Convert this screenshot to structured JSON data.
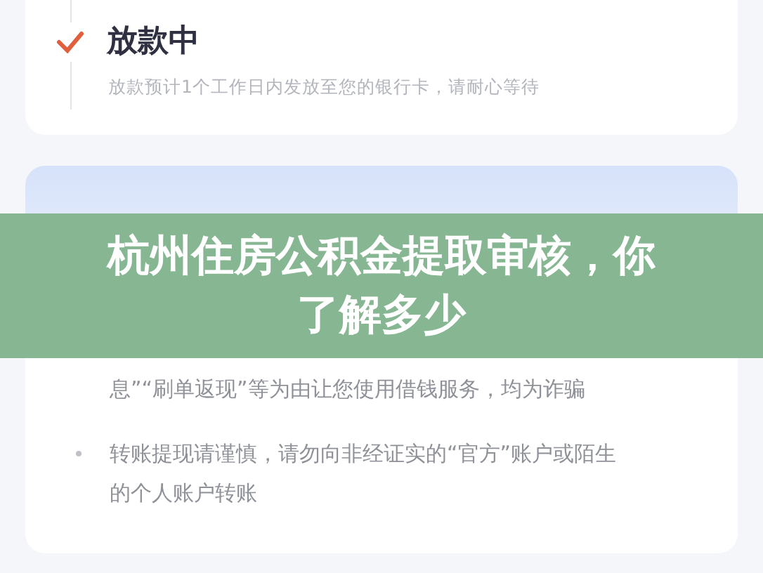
{
  "status_card": {
    "title": "放款中",
    "description": "放款预计1个工作日内发放至您的银行卡，请耐心等待",
    "done": true
  },
  "fraud_card": {
    "tips": [
      "息”“刷单返现”等为由让您使用借钱服务，均为诈骗",
      "转账提现请谨慎，请勿向非经证实的“官方”账户或陌生的个人账户转账"
    ]
  },
  "banner": {
    "title": "杭州住房公积金提取审核，你了解多少"
  }
}
